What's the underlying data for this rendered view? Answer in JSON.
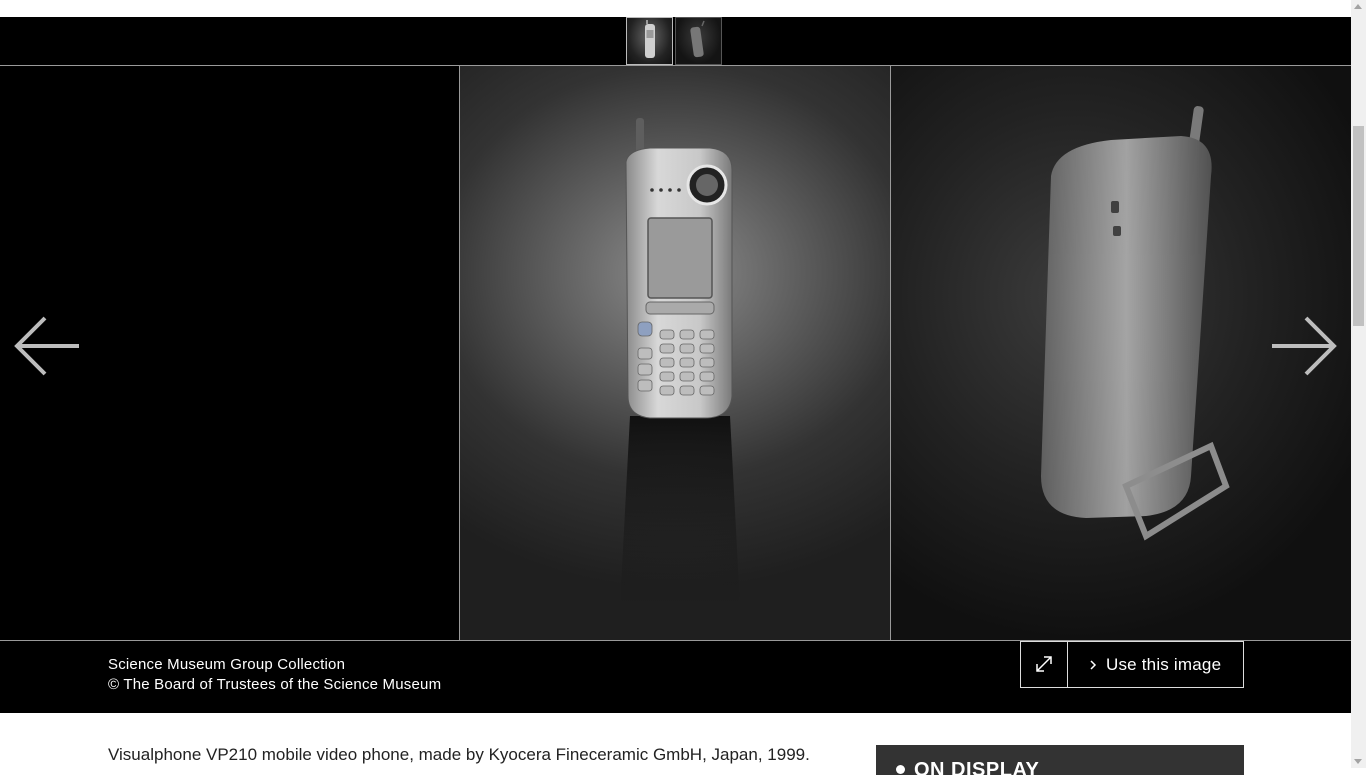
{
  "gallery": {
    "thumbnails": [
      {
        "icon": "phone-front-thumbnail-icon",
        "selected": true
      },
      {
        "icon": "phone-back-thumbnail-icon",
        "selected": false
      }
    ],
    "main_image_icon": "mobile-video-phone-front-image",
    "next_image_icon": "mobile-video-phone-back-image",
    "prev_arrow_icon": "arrow-left-icon",
    "next_arrow_icon": "arrow-right-icon"
  },
  "credits": {
    "collection": "Science Museum Group Collection",
    "copyright": "© The Board of Trustees of the Science Museum"
  },
  "actions": {
    "expand_icon": "expand-icon",
    "use_image_label": "Use this image",
    "use_image_icon": "chevron-right-icon"
  },
  "description": "Visualphone VP210 mobile video phone, made by Kyocera Fineceramic GmbH, Japan, 1999.",
  "on_display": {
    "label": "ON DISPLAY"
  },
  "colors": {
    "background": "#000000",
    "text": "#ffffff",
    "panel": "#333333"
  }
}
